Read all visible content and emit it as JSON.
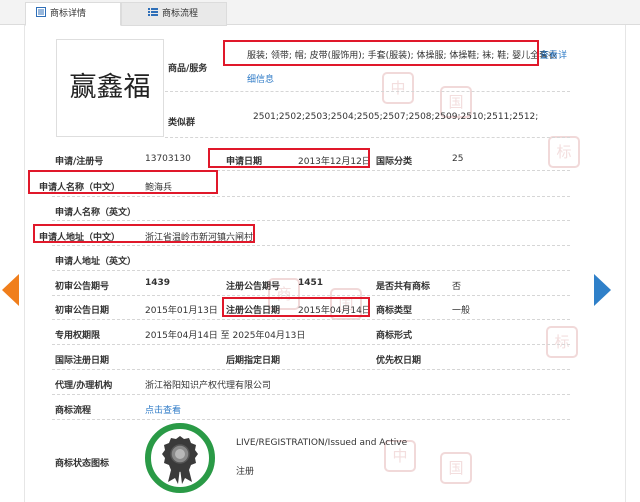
{
  "tabs": {
    "details": "商标详情",
    "flow": "商标流程"
  },
  "logo_text": "赢鑫福",
  "goods": {
    "label": "商品/服务",
    "value": "服装; 领带; 帽; 皮带(服饰用); 手套(服装); 体操服; 体操鞋; 袜; 鞋; 婴儿全套衣",
    "more_link_a": "查看详",
    "more_link_b": "细信息"
  },
  "similar_group": {
    "label": "类似群",
    "value": "2501;2502;2503;2504;2505;2507;2508;2509;2510;2511;2512;"
  },
  "reg_no": {
    "label": "申请/注册号",
    "value": "13703130"
  },
  "apply_date": {
    "label": "申请日期",
    "value": "2013年12月12日"
  },
  "intl_class": {
    "label": "国际分类",
    "value": "25"
  },
  "applicant_cn": {
    "label": "申请人名称（中文）",
    "value": "鲍海兵"
  },
  "applicant_en": {
    "label": "申请人名称（英文）",
    "value": ""
  },
  "address_cn": {
    "label": "申请人地址（中文）",
    "value": "浙江省温岭市新河镇六闸村"
  },
  "address_en": {
    "label": "申请人地址（英文）",
    "value": ""
  },
  "prelim_no": {
    "label": "初审公告期号",
    "value": "1439"
  },
  "reg_pub_no": {
    "label": "注册公告期号",
    "value": "1451"
  },
  "shared": {
    "label": "是否共有商标",
    "value": "否"
  },
  "prelim_date": {
    "label": "初审公告日期",
    "value": "2015年01月13日"
  },
  "reg_pub_date": {
    "label": "注册公告日期",
    "value": "2015年04月14日"
  },
  "tm_type": {
    "label": "商标类型",
    "value": "一般"
  },
  "exclusive": {
    "label": "专用权期限",
    "value": "2015年04月14日 至 2025年04月13日"
  },
  "tm_form": {
    "label": "商标形式",
    "value": ""
  },
  "intl_reg_date": {
    "label": "国际注册日期",
    "value": ""
  },
  "later_date": {
    "label": "后期指定日期",
    "value": ""
  },
  "priority_date": {
    "label": "优先权日期",
    "value": ""
  },
  "agent": {
    "label": "代理/办理机构",
    "value": "浙江裕阳知识产权代理有限公司"
  },
  "process": {
    "label": "商标流程",
    "value": "点击查看"
  },
  "status": {
    "label": "商标状态图标",
    "line1": "LIVE/REGISTRATION/Issued and Active",
    "line2": "注册",
    "badge_color": "#2a9a46"
  },
  "watermark": [
    "中",
    "国",
    "标",
    "商"
  ],
  "colors": {
    "highlight": "#e0182a",
    "link": "#2f7bc7",
    "prev_arrow": "#f07e1b",
    "next_arrow": "#2f80c9"
  }
}
